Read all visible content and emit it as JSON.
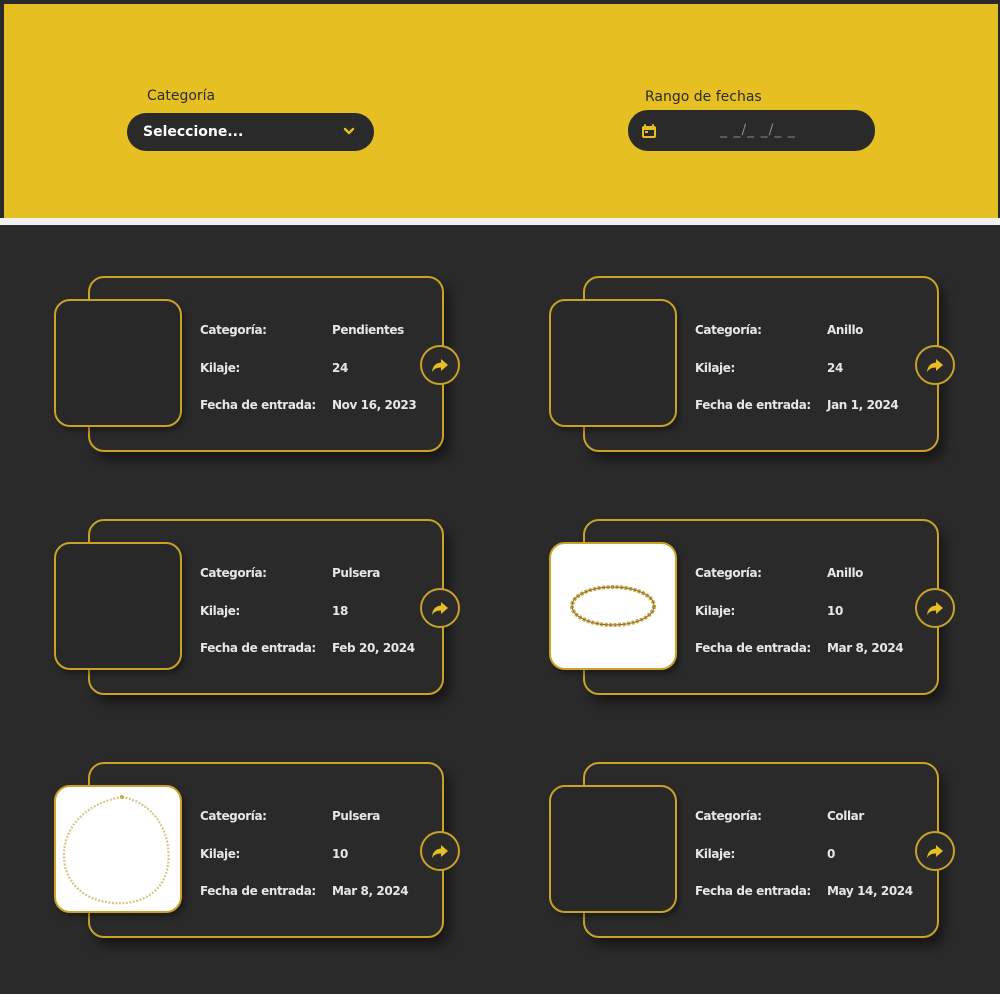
{
  "filters": {
    "category_label": "Categoría",
    "category_value": "Seleccione...",
    "category_icon": "chevron-down-icon",
    "date_label": "Rango de fechas",
    "date_placeholder": "_ _/_ _/_ _",
    "date_icon": "calendar-icon"
  },
  "colors": {
    "accent": "#e6bf22",
    "dark": "#2a2a2a",
    "border": "#c9a227"
  },
  "field_labels": {
    "category": "Categoría:",
    "weight": "Kilaje:",
    "entry_date": "Fecha de entrada:"
  },
  "cards": [
    {
      "category": "Pendientes",
      "weight": "24",
      "entry_date": "Nov 16, 2023",
      "image": "empty",
      "action_icon": "share-arrow-icon"
    },
    {
      "category": "Anillo",
      "weight": "24",
      "entry_date": "Jan 1, 2024",
      "image": "empty",
      "action_icon": "share-arrow-icon"
    },
    {
      "category": "Pulsera",
      "weight": "18",
      "entry_date": "Feb 20, 2024",
      "image": "empty",
      "action_icon": "share-arrow-icon"
    },
    {
      "category": "Anillo",
      "weight": "10",
      "entry_date": "Mar 8, 2024",
      "image": "gold-bracelet-photo",
      "action_icon": "share-arrow-icon"
    },
    {
      "category": "Pulsera",
      "weight": "10",
      "entry_date": "Mar 8, 2024",
      "image": "gold-chain-photo",
      "action_icon": "share-arrow-icon"
    },
    {
      "category": "Collar",
      "weight": "0",
      "entry_date": "May 14, 2024",
      "image": "empty",
      "action_icon": "share-arrow-icon"
    }
  ]
}
